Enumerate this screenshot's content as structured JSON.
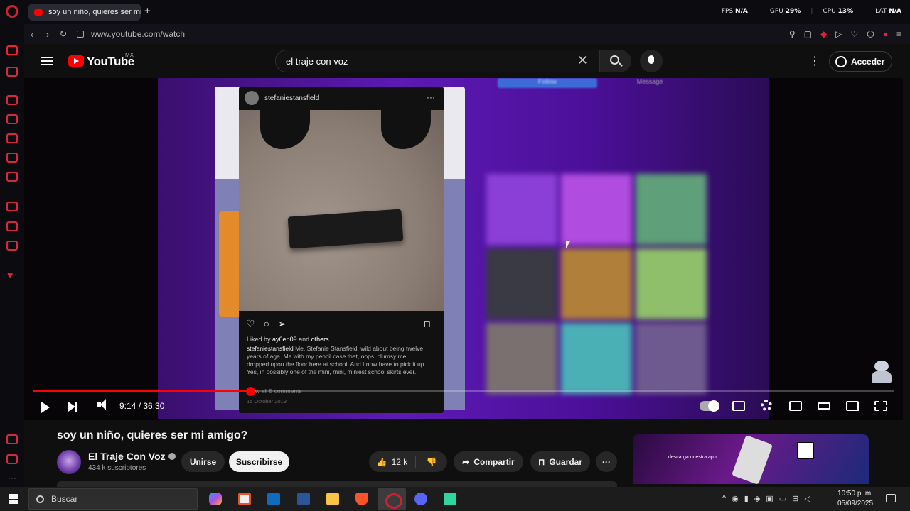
{
  "browser": {
    "tab_title": "soy un niño, quieres ser mi amigo?",
    "url": "www.youtube.com/watch",
    "stats": [
      {
        "label": "FPS",
        "value": "N/A"
      },
      {
        "label": "GPU",
        "value": "29%"
      },
      {
        "label": "CPU",
        "value": "13%"
      },
      {
        "label": "LAT",
        "value": "N/A"
      }
    ],
    "accent_color": "#d02030"
  },
  "youtube": {
    "logo_text": "YouTube",
    "country_code": "MX",
    "search_query": "el traje con voz",
    "signin_label": "Acceder"
  },
  "video": {
    "overlay": {
      "ig_username": "stefaniestansfield",
      "liked_by_user": "ay6en09",
      "liked_by_prefix": "Liked by",
      "liked_by_and": "and",
      "liked_by_others": "others",
      "caption_user": "stefaniestansfield",
      "caption": "Me, Stefanie Stansfield, wild about being twelve years of age. Me with my pencil case that, oops, clumsy me dropped upon the floor here at school. And I now have to pick it up. Yes, in possibly one of the mini, mini, miniest school skirts ever.",
      "comments": "View all 5 comments",
      "date": "15 October 2019",
      "bg_follow": "Follow",
      "bg_message": "Message"
    },
    "time_current": "9:14",
    "time_total": "36:30",
    "time_display": "9:14 / 36:30",
    "progress": 0.2521
  },
  "details": {
    "title": "soy un niño, quieres ser mi amigo?",
    "channel_name": "El Traje Con Voz",
    "subscribers": "434 k suscriptores",
    "join_label": "Unirse",
    "subscribe_label": "Suscribirse",
    "likes": "12 k",
    "share_label": "Compartir",
    "save_label": "Guardar",
    "ad_text": "descarga nuestra app"
  },
  "taskbar": {
    "search_placeholder": "Buscar",
    "time": "10:50 p. m.",
    "date": "05/09/2025"
  }
}
